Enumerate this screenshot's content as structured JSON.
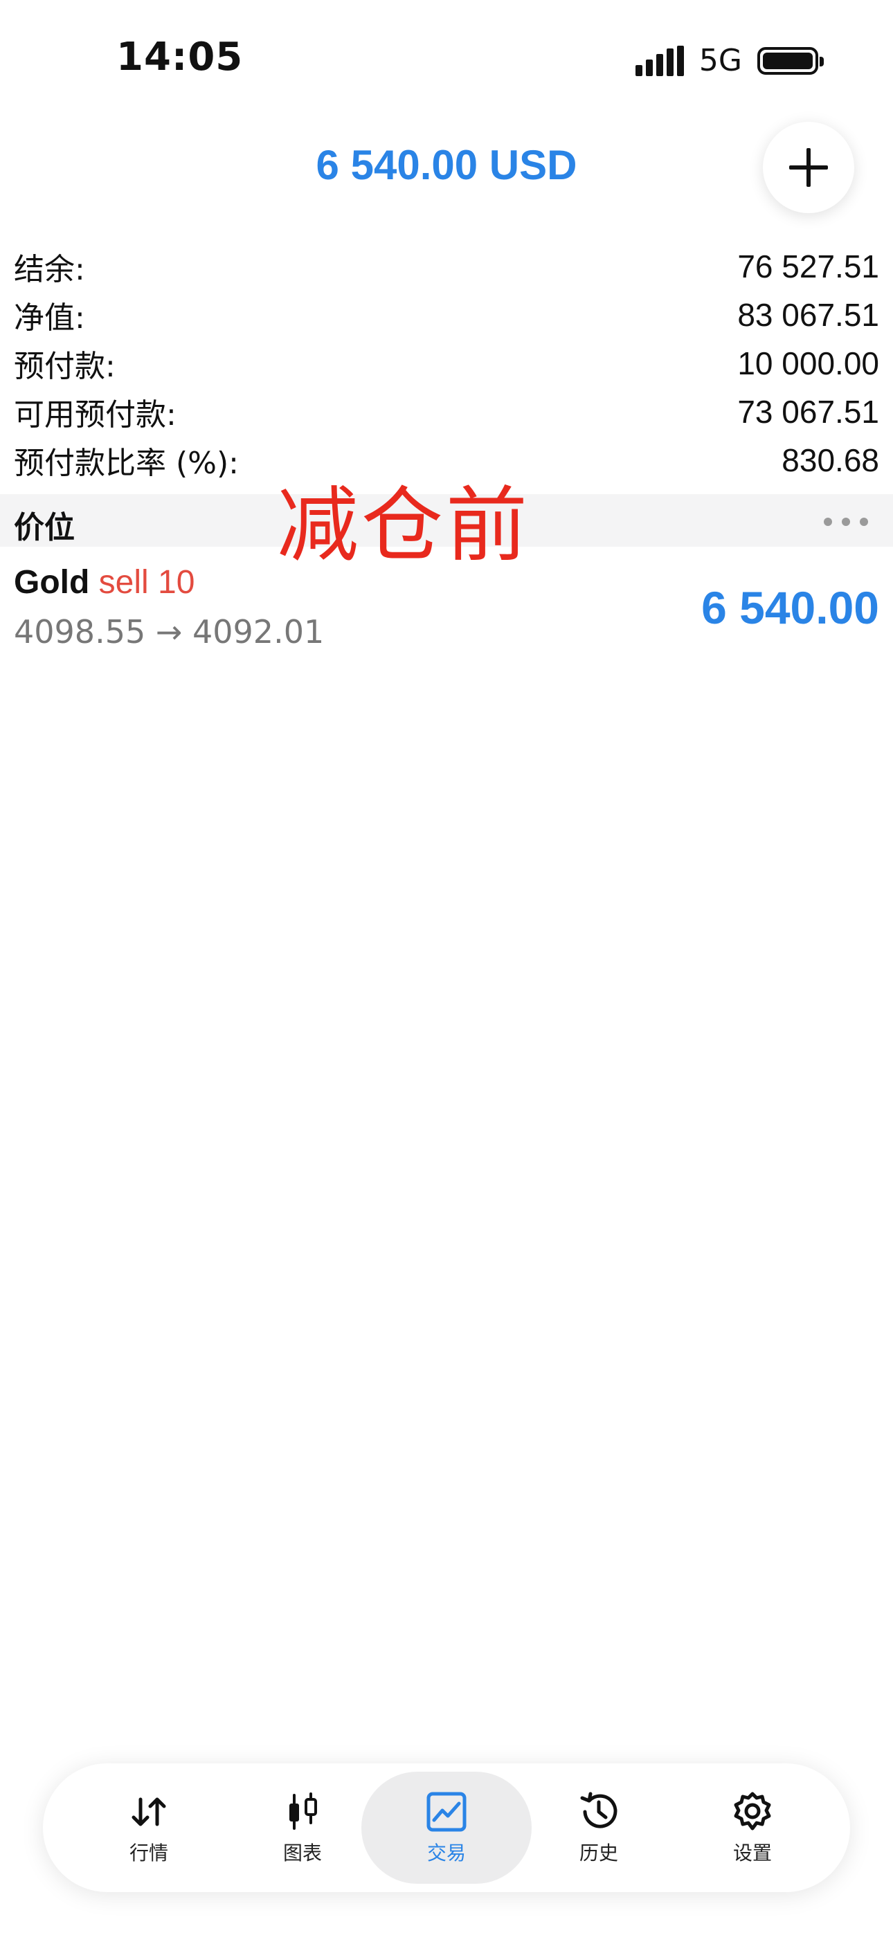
{
  "status_bar": {
    "time": "14:05",
    "network": "5G"
  },
  "header": {
    "title": "6 540.00 USD",
    "add_icon": "plus-icon"
  },
  "summary": [
    {
      "label": "结余:",
      "value": "76 527.51"
    },
    {
      "label": "净值:",
      "value": "83 067.51"
    },
    {
      "label": "预付款:",
      "value": "10 000.00"
    },
    {
      "label": "可用预付款:",
      "value": "73 067.51"
    },
    {
      "label": "预付款比率 (%):",
      "value": "830.68"
    }
  ],
  "section": {
    "title": "价位",
    "more_icon": "more-dots-icon"
  },
  "annotation": "减仓前",
  "position": {
    "symbol": "Gold",
    "side": "sell 10",
    "prices": "4098.55 → 4092.01",
    "profit": "6 540.00"
  },
  "nav": {
    "items": [
      {
        "label": "行情",
        "icon": "quotes-arrows-icon"
      },
      {
        "label": "图表",
        "icon": "candlestick-chart-icon"
      },
      {
        "label": "交易",
        "icon": "trade-line-chart-icon",
        "active": true
      },
      {
        "label": "历史",
        "icon": "history-clock-icon"
      },
      {
        "label": "设置",
        "icon": "settings-gear-icon"
      }
    ]
  },
  "colors": {
    "accent_blue": "#2a84e6",
    "sell_red": "#e34b3f",
    "annotation_red": "#e8291d"
  }
}
